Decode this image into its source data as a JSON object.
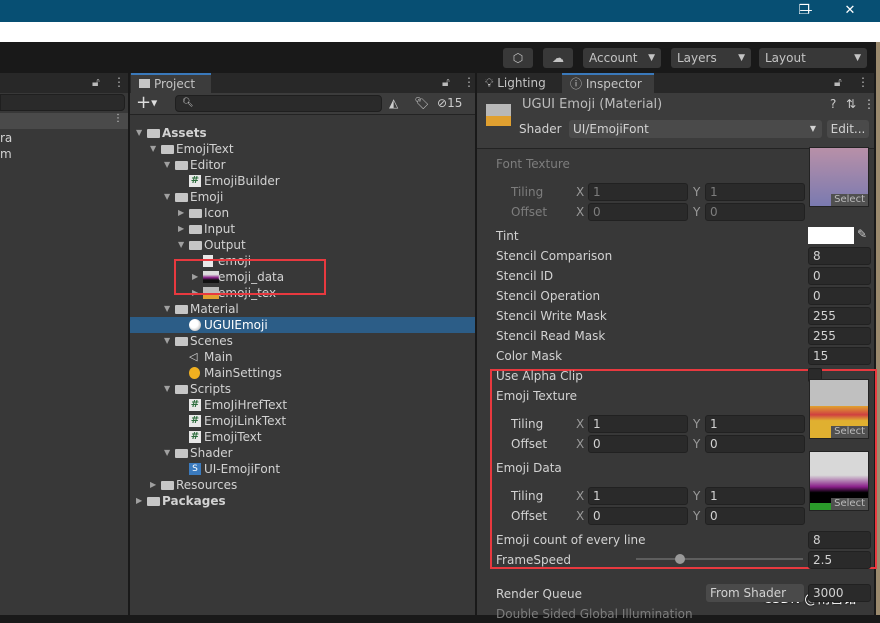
{
  "window": {
    "minimize": "—",
    "restore": "❐",
    "close": "✕"
  },
  "toolbar": {
    "account": "Account",
    "layers": "Layers",
    "layout": "Layout"
  },
  "left_panel": {
    "rows": [
      "ra",
      "m"
    ]
  },
  "project": {
    "tab": "Project",
    "hidden_count": "15",
    "search_placeholder": "",
    "tree": [
      {
        "label": "Assets",
        "level": 0,
        "type": "folder",
        "state": "expanded",
        "bold": true
      },
      {
        "label": "EmojiText",
        "level": 1,
        "type": "folder",
        "state": "expanded"
      },
      {
        "label": "Editor",
        "level": 2,
        "type": "folder",
        "state": "expanded"
      },
      {
        "label": "EmojiBuilder",
        "level": 3,
        "type": "script"
      },
      {
        "label": "Emoji",
        "level": 2,
        "type": "folder",
        "state": "expanded"
      },
      {
        "label": "Icon",
        "level": 3,
        "type": "folder",
        "state": "collapsed"
      },
      {
        "label": "Input",
        "level": 3,
        "type": "folder",
        "state": "collapsed"
      },
      {
        "label": "Output",
        "level": 3,
        "type": "folder",
        "state": "expanded"
      },
      {
        "label": "emoji",
        "level": 4,
        "type": "text"
      },
      {
        "label": "emoji_data",
        "level": 4,
        "type": "texture-data",
        "state": "collapsed"
      },
      {
        "label": "emoji_tex",
        "level": 4,
        "type": "texture-emoji",
        "state": "collapsed"
      },
      {
        "label": "Material",
        "level": 2,
        "type": "folder",
        "state": "expanded"
      },
      {
        "label": "UGUIEmoji",
        "level": 3,
        "type": "material",
        "selected": true
      },
      {
        "label": "Scenes",
        "level": 2,
        "type": "folder",
        "state": "expanded"
      },
      {
        "label": "Main",
        "level": 3,
        "type": "scene"
      },
      {
        "label": "MainSettings",
        "level": 3,
        "type": "settings"
      },
      {
        "label": "Scripts",
        "level": 2,
        "type": "folder",
        "state": "expanded"
      },
      {
        "label": "EmoJiHrefText",
        "level": 3,
        "type": "script"
      },
      {
        "label": "EmojiLinkText",
        "level": 3,
        "type": "script"
      },
      {
        "label": "EmojiText",
        "level": 3,
        "type": "script"
      },
      {
        "label": "Shader",
        "level": 2,
        "type": "folder",
        "state": "expanded"
      },
      {
        "label": "UI-EmojiFont",
        "level": 3,
        "type": "shader"
      },
      {
        "label": "Resources",
        "level": 1,
        "type": "folder",
        "state": "collapsed"
      },
      {
        "label": "Packages",
        "level": 0,
        "type": "folder",
        "state": "collapsed",
        "bold": true
      }
    ]
  },
  "inspector": {
    "tabs": [
      "Lighting",
      "Inspector"
    ],
    "title": "UGUI Emoji (Material)",
    "shader_label": "Shader",
    "shader_value": "UI/EmojiFont",
    "edit_button": "Edit...",
    "font_texture": {
      "label": "Font Texture",
      "tiling": "Tiling",
      "offset": "Offset",
      "tx": "1",
      "ty": "1",
      "ox": "0",
      "oy": "0",
      "select": "Select"
    },
    "tint_label": "Tint",
    "tint_color": "#ffffff",
    "props": [
      {
        "label": "Stencil Comparison",
        "value": "8"
      },
      {
        "label": "Stencil ID",
        "value": "0"
      },
      {
        "label": "Stencil Operation",
        "value": "0"
      },
      {
        "label": "Stencil Write Mask",
        "value": "255"
      },
      {
        "label": "Stencil Read Mask",
        "value": "255"
      },
      {
        "label": "Color Mask",
        "value": "15"
      }
    ],
    "alpha_clip": {
      "label": "Use Alpha Clip",
      "checked": false
    },
    "emoji_texture": {
      "label": "Emoji Texture",
      "tiling": "Tiling",
      "offset": "Offset",
      "tx": "1",
      "ty": "1",
      "ox": "0",
      "oy": "0",
      "select": "Select"
    },
    "emoji_data": {
      "label": "Emoji Data",
      "tiling": "Tiling",
      "offset": "Offset",
      "tx": "1",
      "ty": "1",
      "ox": "0",
      "oy": "0",
      "select": "Select"
    },
    "emoji_count": {
      "label": "Emoji count of every line",
      "value": "8"
    },
    "frame_speed": {
      "label": "FrameSpeed",
      "value": "2.5"
    },
    "render_queue": {
      "label": "Render Queue",
      "mode": "From Shader",
      "value": "3000"
    },
    "double_sided": {
      "label": "Double Sided Global Illumination"
    },
    "x": "X",
    "y": "Y"
  },
  "watermark": "CSDN @南宫铭",
  "colors": {
    "accent": "#2c5d87",
    "highlight": "#e8393f",
    "titlebar": "#074f73"
  }
}
